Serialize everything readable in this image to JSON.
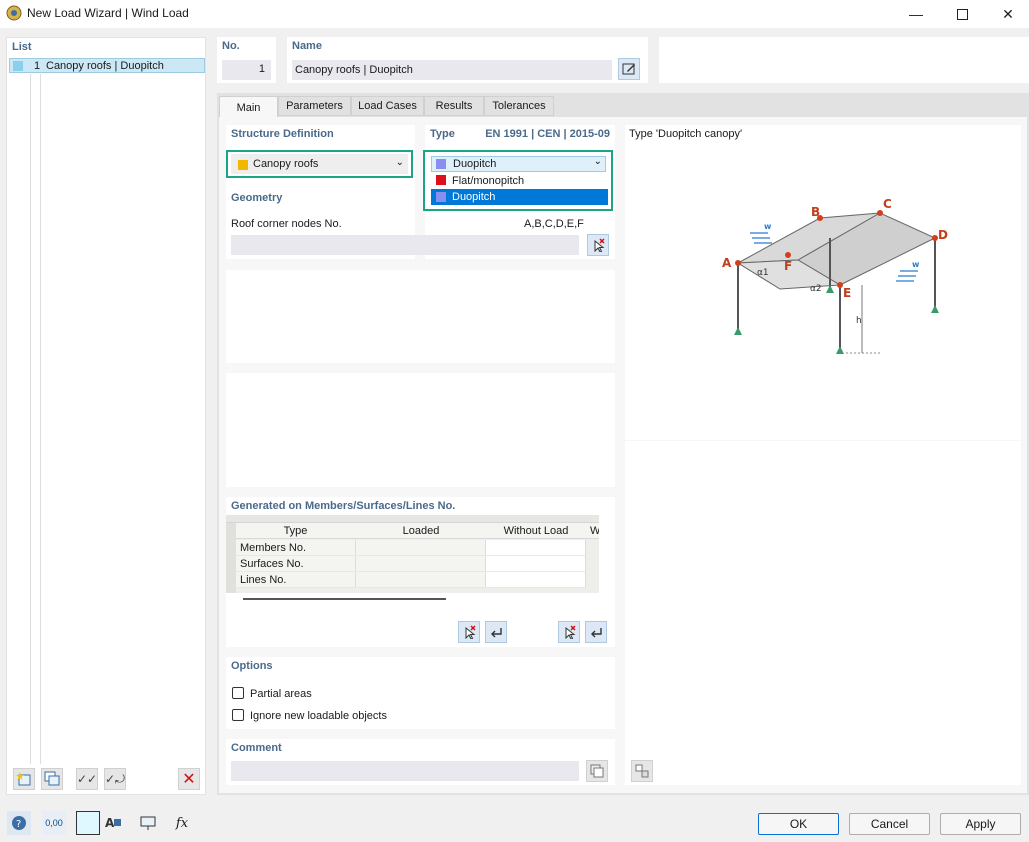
{
  "window": {
    "title": "New Load Wizard | Wind Load"
  },
  "list": {
    "header": "List",
    "items": [
      {
        "number": "1",
        "label": "Canopy roofs | Duopitch"
      }
    ]
  },
  "header": {
    "no_label": "No.",
    "no_value": "1",
    "name_label": "Name",
    "name_value": "Canopy roofs | Duopitch"
  },
  "tabs": [
    "Main",
    "Parameters",
    "Load Cases",
    "Results",
    "Tolerances"
  ],
  "structure": {
    "title": "Structure Definition",
    "selected": "Canopy roofs",
    "selected_color": "#f2b700"
  },
  "type": {
    "title": "Type",
    "standard": "EN 1991 | CEN | 2015-09",
    "selected": "Duopitch",
    "selected_color": "#8a8ef0",
    "options": [
      {
        "label": "Flat/monopitch",
        "color": "#e0101a"
      },
      {
        "label": "Duopitch",
        "color": "#8a8ef0"
      }
    ]
  },
  "geometry": {
    "title": "Geometry",
    "corner_label": "Roof corner nodes No.",
    "corner_value": "A,B,C,D,E,F"
  },
  "generated": {
    "title": "Generated on Members/Surfaces/Lines No.",
    "columns": [
      "Type",
      "Loaded",
      "Without Load",
      "W"
    ],
    "rows": [
      "Members No.",
      "Surfaces No.",
      "Lines No."
    ]
  },
  "options": {
    "title": "Options",
    "partial_areas": "Partial areas",
    "ignore_new": "Ignore new loadable objects"
  },
  "comment": {
    "title": "Comment"
  },
  "preview": {
    "title": "Type 'Duopitch canopy'",
    "labels": {
      "A": "A",
      "B": "B",
      "C": "C",
      "D": "D",
      "E": "E",
      "F": "F",
      "h": "h",
      "w": "w",
      "a1": "α1",
      "a2": "α2"
    }
  },
  "bottom": {
    "zero_label": "0,00"
  },
  "buttons": {
    "ok": "OK",
    "cancel": "Cancel",
    "apply": "Apply"
  }
}
